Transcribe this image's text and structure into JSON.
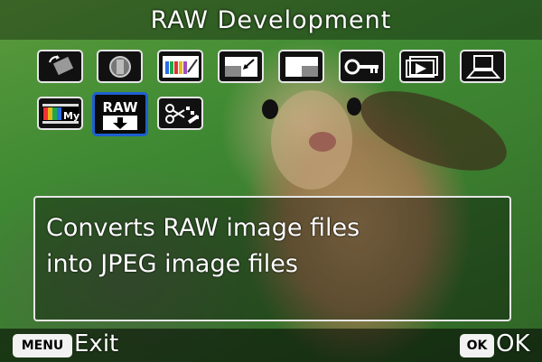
{
  "screen": {
    "title": "RAW Development",
    "menu_icons": [
      {
        "name": "rotate-image-icon"
      },
      {
        "name": "digital-filter-icon"
      },
      {
        "name": "color-palette-icon"
      },
      {
        "name": "resize-icon"
      },
      {
        "name": "cropping-icon"
      },
      {
        "name": "protect-key-icon"
      },
      {
        "name": "slideshow-icon"
      },
      {
        "name": "save-as-start-up-screen-icon"
      },
      {
        "name": "color-moire-correction-icon",
        "label": "My"
      },
      {
        "name": "raw-development-icon",
        "label": "RAW",
        "selected": true
      },
      {
        "name": "movie-edit-icon"
      }
    ],
    "description_lines": [
      "Converts RAW image files",
      "into JPEG image files"
    ],
    "footer": {
      "menu_key": "MENU",
      "menu_action": "Exit",
      "ok_key": "OK",
      "ok_action": "OK"
    },
    "colors": {
      "selection": "#1e5fd0",
      "icon_border": "#e6e6e6",
      "text": "#ffffff"
    }
  }
}
